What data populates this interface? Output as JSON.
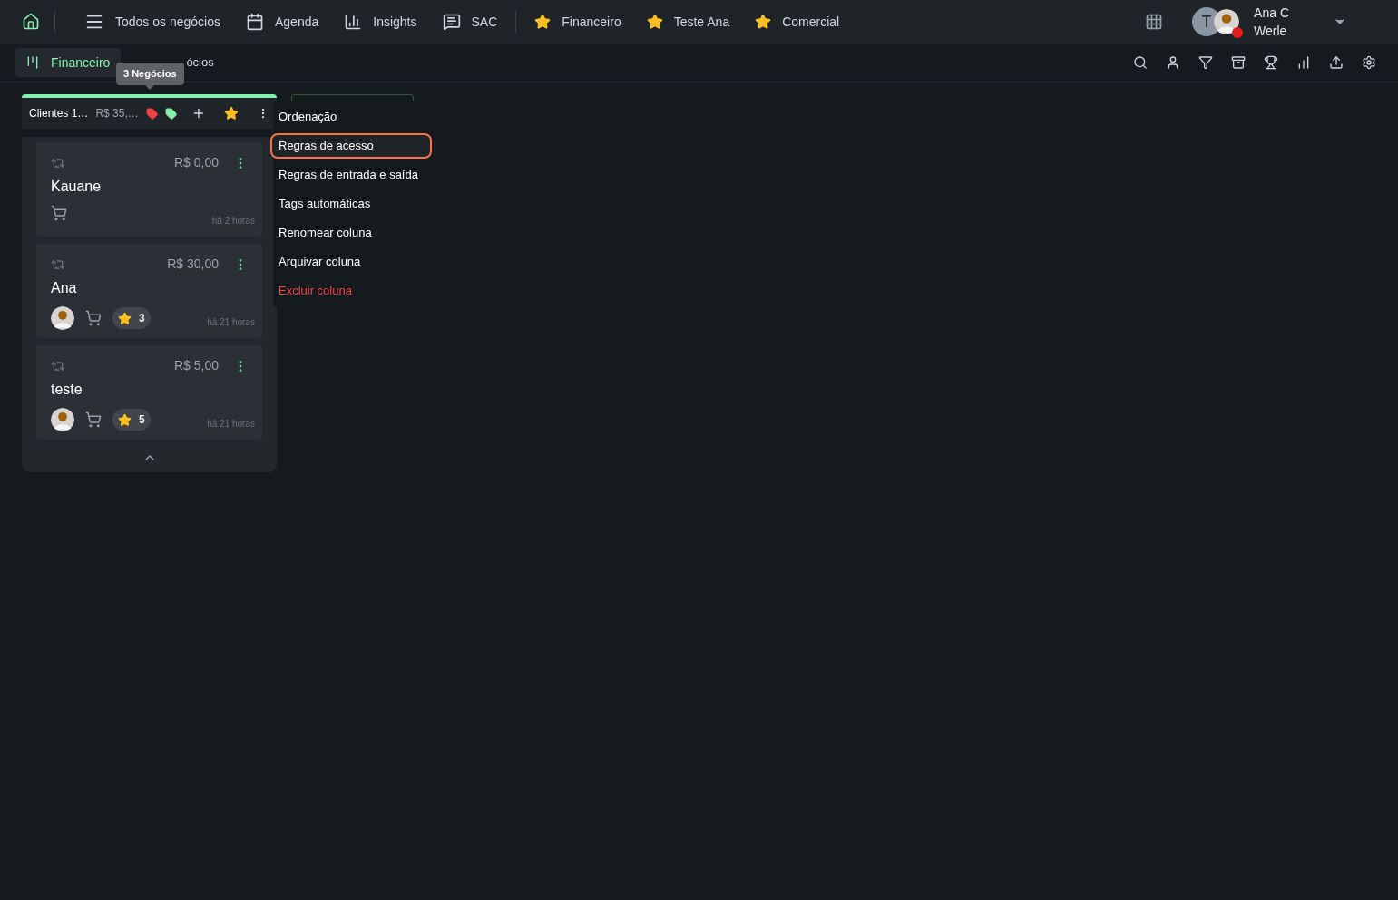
{
  "nav": {
    "items": [
      {
        "kind": "menu",
        "label": "Todos os negócios"
      },
      {
        "kind": "calendar",
        "label": "Agenda"
      },
      {
        "kind": "chart",
        "label": "Insights"
      },
      {
        "kind": "chat",
        "label": "SAC"
      },
      {
        "kind": "star",
        "label": "Financeiro"
      },
      {
        "kind": "star",
        "label": "Teste Ana"
      },
      {
        "kind": "star",
        "label": "Comercial"
      }
    ],
    "user": {
      "initial": "T",
      "name_line1": "Ana C",
      "name_line2": "Werle",
      "online": false
    }
  },
  "board_tab": {
    "label": "Financeiro",
    "selected": true
  },
  "count_label": "ócios",
  "tooltip": "3 Negócios",
  "column": {
    "title": "Clientes 1…",
    "total": "R$ 35,…",
    "tags": [
      {
        "color": "#ef4444"
      },
      {
        "color": "#86efac"
      }
    ],
    "favorite": true,
    "cards": [
      {
        "value": "R$ 0,00",
        "name": "Kauane",
        "avatar": false,
        "time": "há 2 horas"
      },
      {
        "value": "R$ 30,00",
        "name": "Ana",
        "avatar": true,
        "badge": "3",
        "time": "há 21 horas"
      },
      {
        "value": "R$ 5,00",
        "name": "teste",
        "avatar": true,
        "badge": "5",
        "time": "há 21 horas"
      }
    ]
  },
  "menu": [
    {
      "label": "Ordenação",
      "selected": false,
      "danger": false
    },
    {
      "label": "Regras de acesso",
      "selected": true,
      "danger": false
    },
    {
      "label": "Regras de entrada e saída",
      "selected": false,
      "danger": false
    },
    {
      "label": "Tags automáticas",
      "selected": false,
      "danger": false
    },
    {
      "label": "Renomear coluna",
      "selected": false,
      "danger": false
    },
    {
      "label": "Arquivar coluna",
      "selected": false,
      "danger": false
    },
    {
      "label": "Excluir coluna",
      "selected": false,
      "danger": true
    }
  ]
}
